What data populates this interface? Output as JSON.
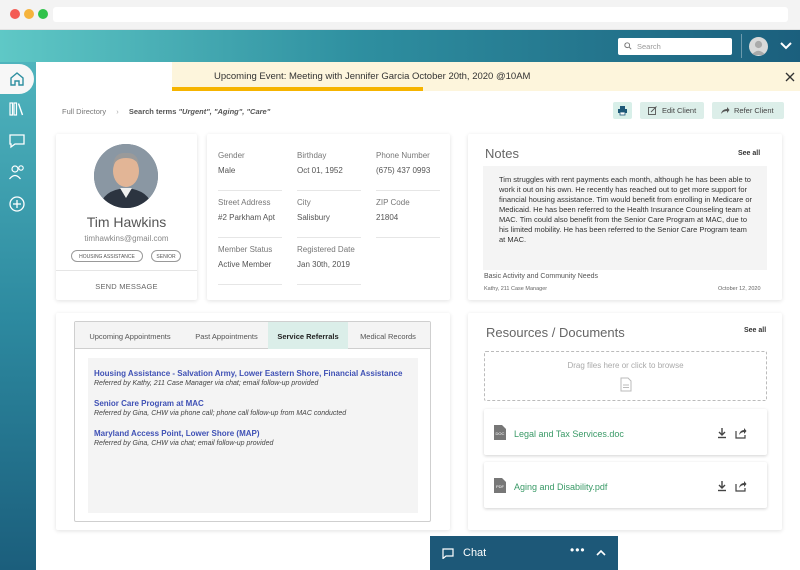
{
  "header": {
    "search_placeholder": "Search"
  },
  "banner": {
    "text": "Upcoming Event: Meeting with Jennifer Garcia October 20th, 2020 @10AM",
    "progress": 0.4
  },
  "breadcrumb": {
    "root": "Full Directory",
    "current_prefix": "Search terms",
    "current_terms": "\"Urgent\", \"Aging\", \"Care\""
  },
  "actions": {
    "edit": "Edit Client",
    "refer": "Refer Client"
  },
  "profile": {
    "name": "Tim Hawkins",
    "email": "timhawkins@gmail.com",
    "tags": [
      "HOUSING ASSISTANCE",
      "SENIOR"
    ],
    "send_message": "SEND MESSAGE"
  },
  "info": {
    "fields": [
      {
        "label": "Gender",
        "value": "Male"
      },
      {
        "label": "Birthday",
        "value": "Oct 01, 1952"
      },
      {
        "label": "Phone Number",
        "value": "(675) 437 0993"
      },
      {
        "label": "Street Address",
        "value": "#2 Parkham Apt"
      },
      {
        "label": "City",
        "value": "Salisbury"
      },
      {
        "label": "ZIP Code",
        "value": "21804"
      },
      {
        "label": "Member Status",
        "value": "Active Member"
      },
      {
        "label": "Registered Date",
        "value": "Jan 30th, 2019"
      }
    ]
  },
  "notes": {
    "title": "Notes",
    "see_all": "See all",
    "text": "Tim struggles with rent payments each month, although he has been able to work it out on his own. He recently has reached out to get more support for financial housing assistance. Tim would benefit from enrolling in Medicare or Medicaid. He has been referred to the Health Insurance Counseling team at MAC. Tim could also benefit from the Senior Care Program at MAC, due to his limited mobility. He has been referred to the Senior Care Program team at MAC.",
    "category": "Basic Activity and Community Needs",
    "author": "Kathy, 211 Case Manager",
    "date": "October 12, 2020"
  },
  "referrals": {
    "tabs": [
      "Upcoming Appointments",
      "Past Appointments",
      "Service Referrals",
      "Medical Records"
    ],
    "active_tab": "Service Referrals",
    "items": [
      {
        "title": "Housing Assistance - Salvation Army, Lower Eastern Shore, Financial Assistance",
        "desc": "Referred by Kathy, 211 Case Manager via chat; email follow-up provided"
      },
      {
        "title": "Senior Care Program at MAC",
        "desc": "Referred by Gina, CHW via phone call; phone call follow-up from MAC conducted"
      },
      {
        "title": "Maryland Access Point, Lower Shore (MAP)",
        "desc": "Referred by Gina, CHW via chat; email follow-up provided"
      }
    ]
  },
  "resources": {
    "title": "Resources / Documents",
    "see_all": "See all",
    "dropzone": "Drag files here or click to browse",
    "files": [
      {
        "name": "Legal and Tax Services.doc",
        "type": "DOC"
      },
      {
        "name": "Aging and Disability.pdf",
        "type": "PDF"
      }
    ]
  },
  "chat": {
    "label": "Chat",
    "more": "•••"
  },
  "colors": {
    "accent": "#2e8fa0",
    "link": "#3f51b5",
    "file_link": "#3a9a67",
    "banner_bar": "#f6b400",
    "chat_bg": "#1d5878"
  }
}
